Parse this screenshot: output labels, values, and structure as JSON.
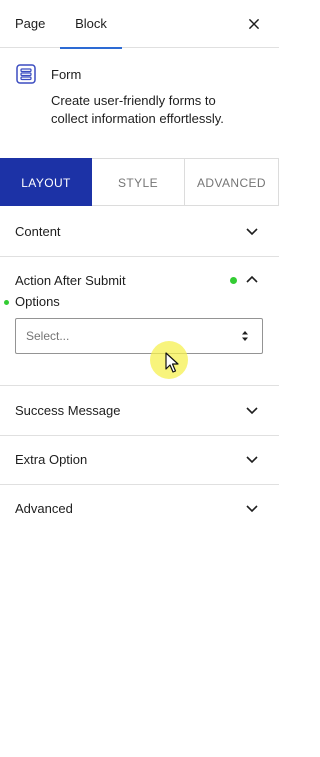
{
  "top_tabs": {
    "page_label": "Page",
    "block_label": "Block",
    "active": "Block"
  },
  "block_card": {
    "title": "Form",
    "description": "Create user-friendly forms to collect information effortlessly.",
    "icon": "form-icon"
  },
  "style_tabs": [
    {
      "label": "LAYOUT",
      "active": true
    },
    {
      "label": "STYLE",
      "active": false
    },
    {
      "label": "ADVANCED",
      "active": false
    }
  ],
  "panels": {
    "content": {
      "title": "Content",
      "expanded": false
    },
    "action_after_submit": {
      "title": "Action After Submit",
      "expanded": true,
      "modified_indicator_color": "#33cc33",
      "options_label": "Options",
      "select_placeholder": "Select..."
    },
    "success_message": {
      "title": "Success Message",
      "expanded": false
    },
    "extra_option": {
      "title": "Extra Option",
      "expanded": false
    },
    "advanced": {
      "title": "Advanced",
      "expanded": false
    }
  },
  "colors": {
    "accent": "#1c32a6",
    "active_underline": "#2d6bd4",
    "indicator": "#33cc33"
  }
}
